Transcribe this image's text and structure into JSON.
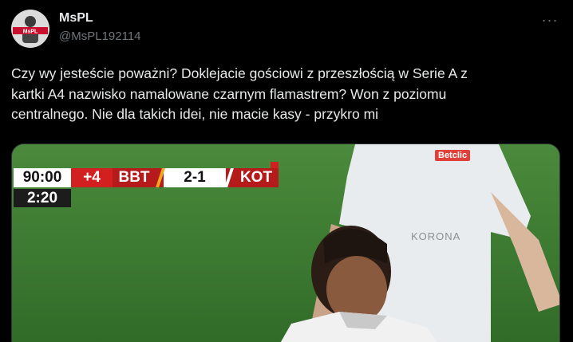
{
  "author": {
    "name": "MsPL",
    "handle": "@MsPL192114",
    "avatar_label": "MsPL"
  },
  "tweet": {
    "text": "Czy wy jesteście poważni? Doklejacie gościowi z przeszłością w Serie A z\nkartki A4 nazwisko namalowane czarnym flamastrem? Won z poziomu\ncentralnego. Nie dla takich idei, nie macie kasy - przykro mi"
  },
  "menu": {
    "icon": "more-dots-icon",
    "label": "···"
  },
  "scoreboard": {
    "time": "90:00",
    "added": "+4",
    "home": "BBT",
    "result": "2-1",
    "away": "KOT",
    "extra": "2:20"
  },
  "shirt": {
    "brand": "KORONA",
    "sponsor": "Betclic"
  },
  "colors": {
    "background": "#000000",
    "text": "#e7e9ea",
    "muted": "#71767b",
    "scoreboard_red": "#b51b1b",
    "pitch": "#3f7a33"
  }
}
